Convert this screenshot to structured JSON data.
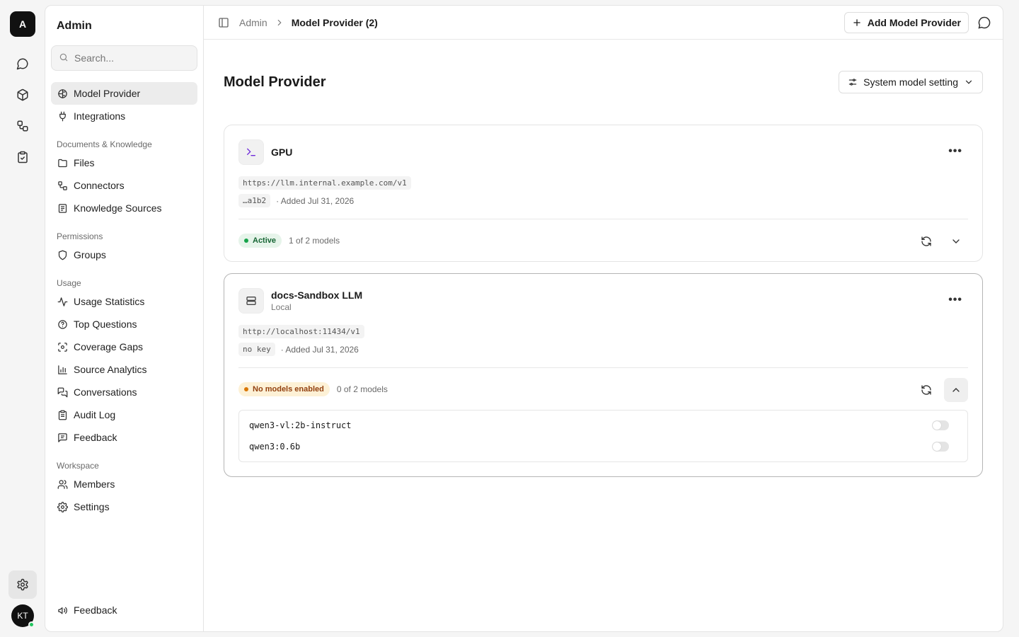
{
  "rail": {
    "logo_letter": "A",
    "icons": [
      "chat-icon",
      "cube-icon",
      "workflow-icon",
      "clipboard-check-icon"
    ],
    "avatar_initials": "KT"
  },
  "sidebar": {
    "title": "Admin",
    "search": {
      "placeholder": "Search..."
    },
    "top_items": [
      {
        "label": "Model Provider",
        "icon": "brain-icon",
        "active": true
      },
      {
        "label": "Integrations",
        "icon": "plug-icon"
      }
    ],
    "sections": [
      {
        "label": "Documents & Knowledge",
        "items": [
          {
            "label": "Files",
            "icon": "folder-icon"
          },
          {
            "label": "Connectors",
            "icon": "connector-icon"
          },
          {
            "label": "Knowledge Sources",
            "icon": "book-icon"
          }
        ]
      },
      {
        "label": "Permissions",
        "items": [
          {
            "label": "Groups",
            "icon": "shield-icon"
          }
        ]
      },
      {
        "label": "Usage",
        "items": [
          {
            "label": "Usage Statistics",
            "icon": "activity-icon"
          },
          {
            "label": "Top Questions",
            "icon": "help-circle-icon"
          },
          {
            "label": "Coverage Gaps",
            "icon": "scan-icon"
          },
          {
            "label": "Source Analytics",
            "icon": "bar-chart-icon"
          },
          {
            "label": "Conversations",
            "icon": "messages-icon"
          },
          {
            "label": "Audit Log",
            "icon": "clipboard-icon"
          },
          {
            "label": "Feedback",
            "icon": "message-square-icon"
          }
        ]
      },
      {
        "label": "Workspace",
        "items": [
          {
            "label": "Members",
            "icon": "users-icon"
          },
          {
            "label": "Settings",
            "icon": "gear-icon"
          }
        ]
      }
    ],
    "footer": {
      "label": "Feedback",
      "icon": "megaphone-icon"
    }
  },
  "topbar": {
    "crumb_root": "Admin",
    "crumb_current": "Model Provider (2)",
    "add_button": "Add Model Provider"
  },
  "page": {
    "title": "Model Provider",
    "system_setting_button": "System model setting"
  },
  "providers": [
    {
      "name": "GPU",
      "subtitle": "",
      "icon": "terminal-icon",
      "url": "https://llm.internal.example.com/v1",
      "key": "…a1b2",
      "added": "· Added Jul 31, 2026",
      "status": "Active",
      "status_color": "#16a34a",
      "model_count": "1 of 2 models",
      "expanded": false,
      "models": []
    },
    {
      "name": "docs-Sandbox LLM",
      "subtitle": "Local",
      "icon": "server-icon",
      "url": "http://localhost:11434/v1",
      "key": "no key",
      "added": "· Added Jul 31, 2026",
      "status": "No models enabled",
      "status_color": "#d97706",
      "model_count": "0 of 2 models",
      "expanded": true,
      "models": [
        {
          "name": "qwen3-vl:2b-instruct",
          "enabled": false
        },
        {
          "name": "qwen3:0.6b",
          "enabled": false
        }
      ]
    }
  ],
  "colors": {
    "active_badge_bg": "#e6f4ea",
    "warning_badge_bg": "#fdf1d6",
    "warning_badge_text": "#92400e"
  }
}
